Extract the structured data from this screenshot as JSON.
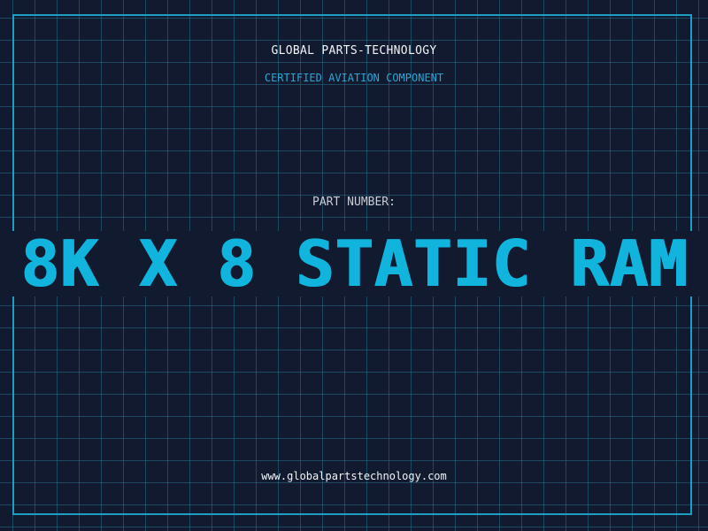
{
  "header": {
    "company": "GLOBAL PARTS-TECHNOLOGY",
    "subtitle": "CERTIFIED AVIATION COMPONENT"
  },
  "part": {
    "label": "PART NUMBER:",
    "value": "8K X 8 STATIC RAM"
  },
  "footer": {
    "website": "www.globalpartstechnology.com"
  },
  "colors": {
    "background": "#111a2e",
    "grid": "#266e8c",
    "accent": "#10b4dc",
    "frame": "#1f9ec4",
    "text": "#f2f4f8"
  }
}
